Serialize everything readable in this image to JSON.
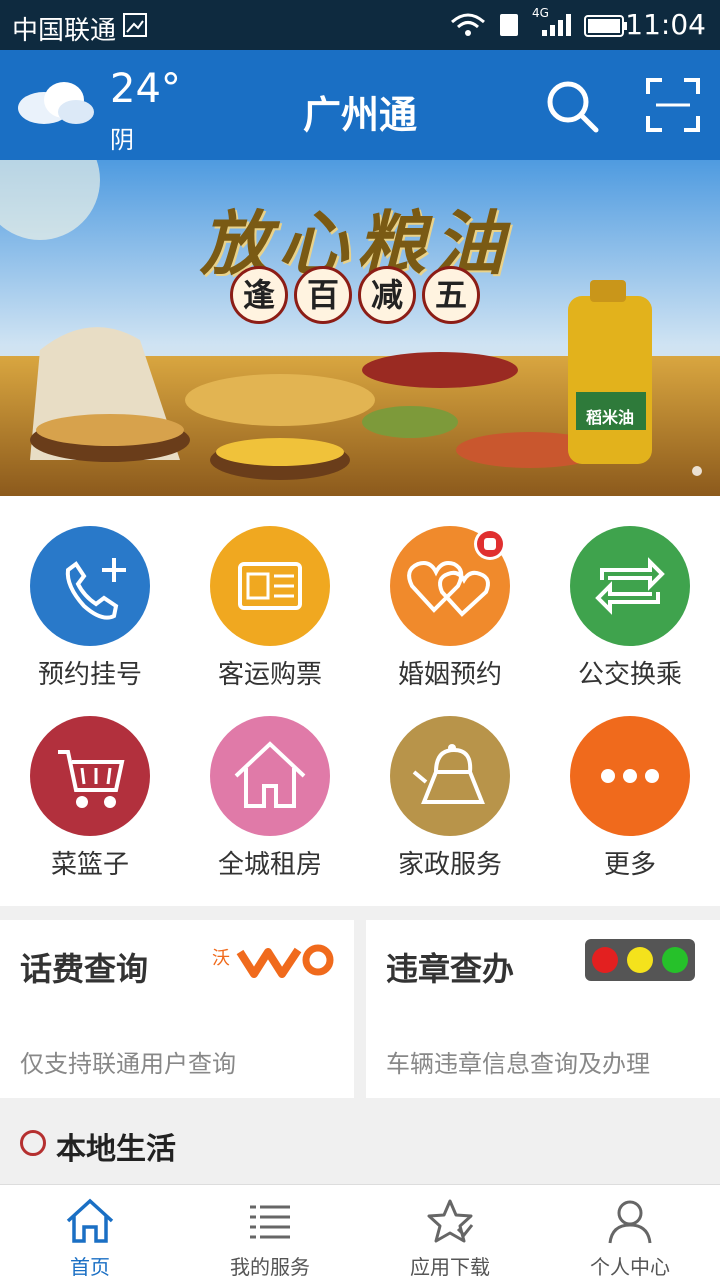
{
  "statusbar": {
    "carrier": "中国联通",
    "network": "4G",
    "time": "11:04"
  },
  "header": {
    "temperature": "24°",
    "weather": "阴",
    "title": "广州通"
  },
  "banner": {
    "headline": "放心粮油",
    "sub_chars": [
      "逢",
      "百",
      "减",
      "五"
    ],
    "bottle_label": "稻米油"
  },
  "services": [
    {
      "label": "预约挂号",
      "color": "#2979c9",
      "icon": "phone-plus-icon"
    },
    {
      "label": "客运购票",
      "color": "#f0a820",
      "icon": "ticket-icon"
    },
    {
      "label": "婚姻预约",
      "color": "#f08a2c",
      "icon": "hearts-icon"
    },
    {
      "label": "公交换乘",
      "color": "#3fa34d",
      "icon": "transfer-icon"
    },
    {
      "label": "菜篮子",
      "color": "#b2303d",
      "icon": "cart-icon"
    },
    {
      "label": "全城租房",
      "color": "#e07aa8",
      "icon": "house-icon"
    },
    {
      "label": "家政服务",
      "color": "#b8944a",
      "icon": "kettle-icon"
    },
    {
      "label": "更多",
      "color": "#f06a1c",
      "icon": "more-icon"
    }
  ],
  "cards": [
    {
      "title": "话费查询",
      "desc": "仅支持联通用户查询",
      "logo_text": "沃"
    },
    {
      "title": "违章查办",
      "desc": "车辆违章信息查询及办理"
    }
  ],
  "section": {
    "title": "本地生活"
  },
  "tabs": [
    {
      "label": "首页",
      "icon": "home-icon",
      "active": true
    },
    {
      "label": "我的服务",
      "icon": "list-icon",
      "active": false
    },
    {
      "label": "应用下载",
      "icon": "star-download-icon",
      "active": false
    },
    {
      "label": "个人中心",
      "icon": "person-icon",
      "active": false
    }
  ],
  "colors": {
    "header": "#1a6fc4",
    "statusbar": "#0e2a3f",
    "tab_active": "#1a6fc4"
  }
}
